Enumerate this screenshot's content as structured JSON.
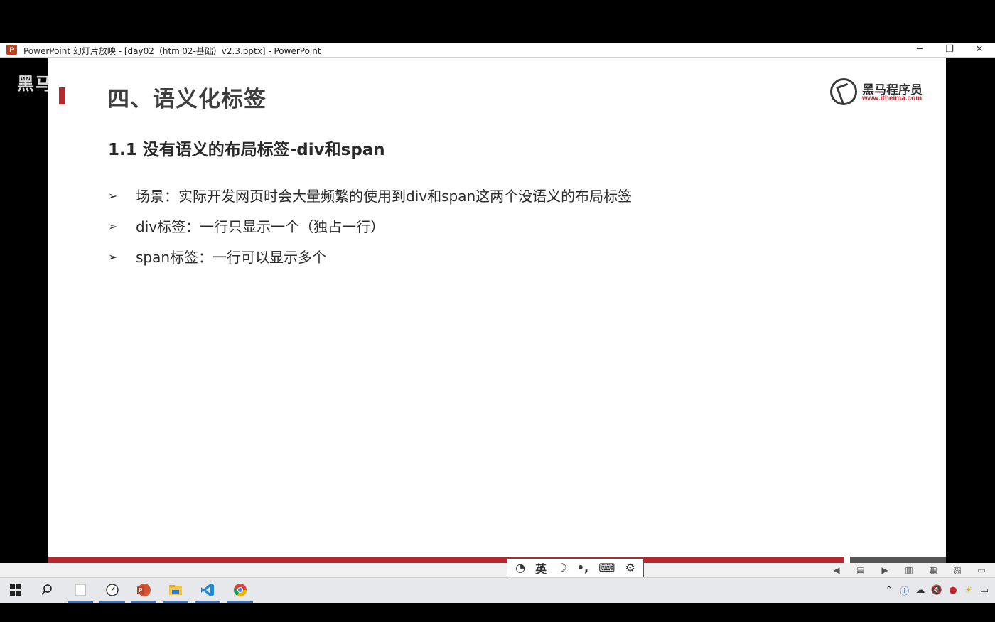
{
  "window": {
    "title": "PowerPoint 幻灯片放映 - [day02（html02-基础）v2.3.pptx] - PowerPoint",
    "minimize_glyph": "─",
    "maximize_glyph": "❐",
    "close_glyph": "✕"
  },
  "watermark": "黑马",
  "slide": {
    "heading": "四、语义化标签",
    "logo": {
      "brand": "黑马程序员",
      "url": "www.itheima.com"
    },
    "subheading": "1.1 没有语义的布局标签-div和span",
    "bullet_marker": "➢",
    "bullets": [
      "场景：实际开发网页时会大量频繁的使用到div和span这两个没语义的布局标签",
      "div标签：一行只显示一个（独占一行）",
      "span标签：一行可以显示多个"
    ],
    "colors": {
      "accent": "#b3272d",
      "text": "#2a2a2a"
    }
  },
  "ime_toolbar": {
    "items": [
      "logo-icon",
      "英",
      "moon-icon",
      "punctuation-icon",
      "keyboard-icon",
      "gear-icon"
    ],
    "mode_label": "英",
    "symbols": {
      "logo": "◔",
      "moon": "☽",
      "punct": "•,",
      "keyboard": "⌨",
      "gear": "⚙"
    }
  },
  "slideshow_controls": [
    "prev-icon",
    "menu-icon",
    "next-icon",
    "normal-view-icon",
    "sorter-view-icon",
    "reading-view-icon",
    "slideshow-view-icon"
  ],
  "taskbar": {
    "apps": [
      "start",
      "search",
      "notepad",
      "clock-app",
      "powerpoint",
      "file-explorer",
      "vscode",
      "chrome"
    ],
    "tray": [
      "chevron-up-icon",
      "info-icon",
      "cloud-icon",
      "volume-mute-icon",
      "app-icon",
      "weather-icon",
      "notification-icon"
    ]
  }
}
